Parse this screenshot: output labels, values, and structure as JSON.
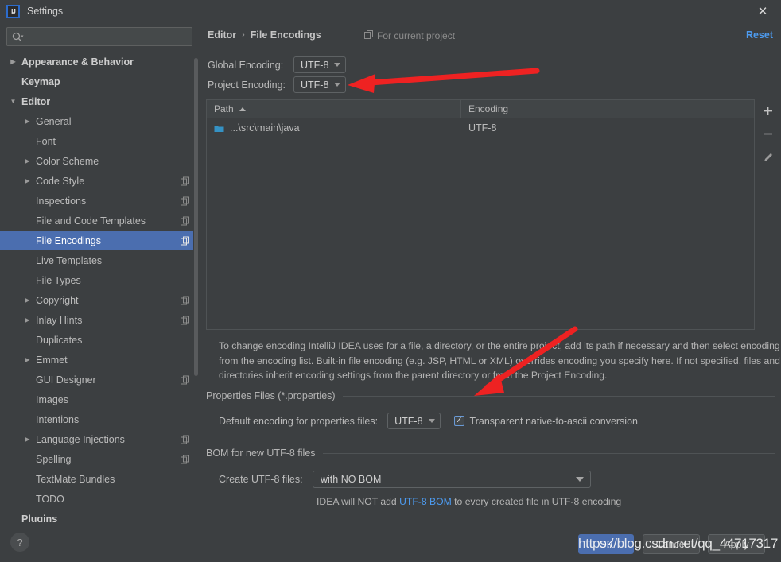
{
  "window": {
    "title": "Settings",
    "logo_text": "IJ",
    "close_icon": "✕"
  },
  "sidebar": {
    "search": {
      "placeholder": "",
      "value": "",
      "icon": "search-icon"
    },
    "items": [
      {
        "label": "Appearance & Behavior",
        "arrow": "▶",
        "indent": 0,
        "bold": true,
        "badge": false,
        "selected": false
      },
      {
        "label": "Keymap",
        "arrow": "",
        "indent": 0,
        "bold": true,
        "badge": false,
        "selected": false
      },
      {
        "label": "Editor",
        "arrow": "▼",
        "indent": 0,
        "bold": true,
        "badge": false,
        "selected": false
      },
      {
        "label": "General",
        "arrow": "▶",
        "indent": 1,
        "bold": false,
        "badge": false,
        "selected": false
      },
      {
        "label": "Font",
        "arrow": "",
        "indent": 1,
        "bold": false,
        "badge": false,
        "selected": false
      },
      {
        "label": "Color Scheme",
        "arrow": "▶",
        "indent": 1,
        "bold": false,
        "badge": false,
        "selected": false
      },
      {
        "label": "Code Style",
        "arrow": "▶",
        "indent": 1,
        "bold": false,
        "badge": true,
        "selected": false
      },
      {
        "label": "Inspections",
        "arrow": "",
        "indent": 1,
        "bold": false,
        "badge": true,
        "selected": false
      },
      {
        "label": "File and Code Templates",
        "arrow": "",
        "indent": 1,
        "bold": false,
        "badge": true,
        "selected": false
      },
      {
        "label": "File Encodings",
        "arrow": "",
        "indent": 1,
        "bold": false,
        "badge": true,
        "selected": true
      },
      {
        "label": "Live Templates",
        "arrow": "",
        "indent": 1,
        "bold": false,
        "badge": false,
        "selected": false
      },
      {
        "label": "File Types",
        "arrow": "",
        "indent": 1,
        "bold": false,
        "badge": false,
        "selected": false
      },
      {
        "label": "Copyright",
        "arrow": "▶",
        "indent": 1,
        "bold": false,
        "badge": true,
        "selected": false
      },
      {
        "label": "Inlay Hints",
        "arrow": "▶",
        "indent": 1,
        "bold": false,
        "badge": true,
        "selected": false
      },
      {
        "label": "Duplicates",
        "arrow": "",
        "indent": 1,
        "bold": false,
        "badge": false,
        "selected": false
      },
      {
        "label": "Emmet",
        "arrow": "▶",
        "indent": 1,
        "bold": false,
        "badge": false,
        "selected": false
      },
      {
        "label": "GUI Designer",
        "arrow": "",
        "indent": 1,
        "bold": false,
        "badge": true,
        "selected": false
      },
      {
        "label": "Images",
        "arrow": "",
        "indent": 1,
        "bold": false,
        "badge": false,
        "selected": false
      },
      {
        "label": "Intentions",
        "arrow": "",
        "indent": 1,
        "bold": false,
        "badge": false,
        "selected": false
      },
      {
        "label": "Language Injections",
        "arrow": "▶",
        "indent": 1,
        "bold": false,
        "badge": true,
        "selected": false
      },
      {
        "label": "Spelling",
        "arrow": "",
        "indent": 1,
        "bold": false,
        "badge": true,
        "selected": false
      },
      {
        "label": "TextMate Bundles",
        "arrow": "",
        "indent": 1,
        "bold": false,
        "badge": false,
        "selected": false
      },
      {
        "label": "TODO",
        "arrow": "",
        "indent": 1,
        "bold": false,
        "badge": false,
        "selected": false
      },
      {
        "label": "Plugins",
        "arrow": "",
        "indent": 0,
        "bold": true,
        "badge": false,
        "selected": false
      }
    ]
  },
  "main": {
    "breadcrumb": {
      "root": "Editor",
      "separator": "›",
      "leaf": "File Encodings"
    },
    "for_current_project": "For current project",
    "reset_label": "Reset",
    "global_encoding": {
      "label": "Global Encoding:",
      "value": "UTF-8"
    },
    "project_encoding": {
      "label": "Project Encoding:",
      "value": "UTF-8"
    },
    "table": {
      "columns": [
        "Path",
        "Encoding"
      ],
      "sort_column": "Path",
      "sort_direction": "asc",
      "rows": [
        {
          "path": "...\\src\\main\\java",
          "encoding": "UTF-8"
        }
      ],
      "tools": {
        "add": "+",
        "remove": "−",
        "edit": "edit-pencil-icon"
      }
    },
    "description": "To change encoding IntelliJ IDEA uses for a file, a directory, or the entire project, add its path if necessary and then select encoding from the encoding list. Built-in file encoding (e.g. JSP, HTML or XML) overrides encoding you specify here. If not specified, files and directories inherit encoding settings from the parent directory or from the Project Encoding.",
    "properties_section": {
      "title": "Properties Files (*.properties)",
      "default_encoding_label": "Default encoding for properties files:",
      "default_encoding_value": "UTF-8",
      "transparent_checkbox_label": "Transparent native-to-ascii conversion",
      "transparent_checked": true,
      "check_glyph": "✓"
    },
    "bom_section": {
      "title": "BOM for new UTF-8 files",
      "create_label": "Create UTF-8 files:",
      "create_value": "with NO BOM",
      "note_prefix": "IDEA will NOT add ",
      "note_highlight": "UTF-8 BOM",
      "note_suffix": " to every created file in UTF-8 encoding"
    }
  },
  "bottom": {
    "help": "?",
    "ok": "OK",
    "cancel": "Cancel",
    "apply": "Apply"
  },
  "watermark": "https://blog.csdn.net/qq_44717317",
  "colors": {
    "background": "#3c3f41",
    "selection": "#4b6eaf",
    "link": "#4d9bf0",
    "annotation_arrow": "#ee2222",
    "folder": "#3592c4"
  }
}
